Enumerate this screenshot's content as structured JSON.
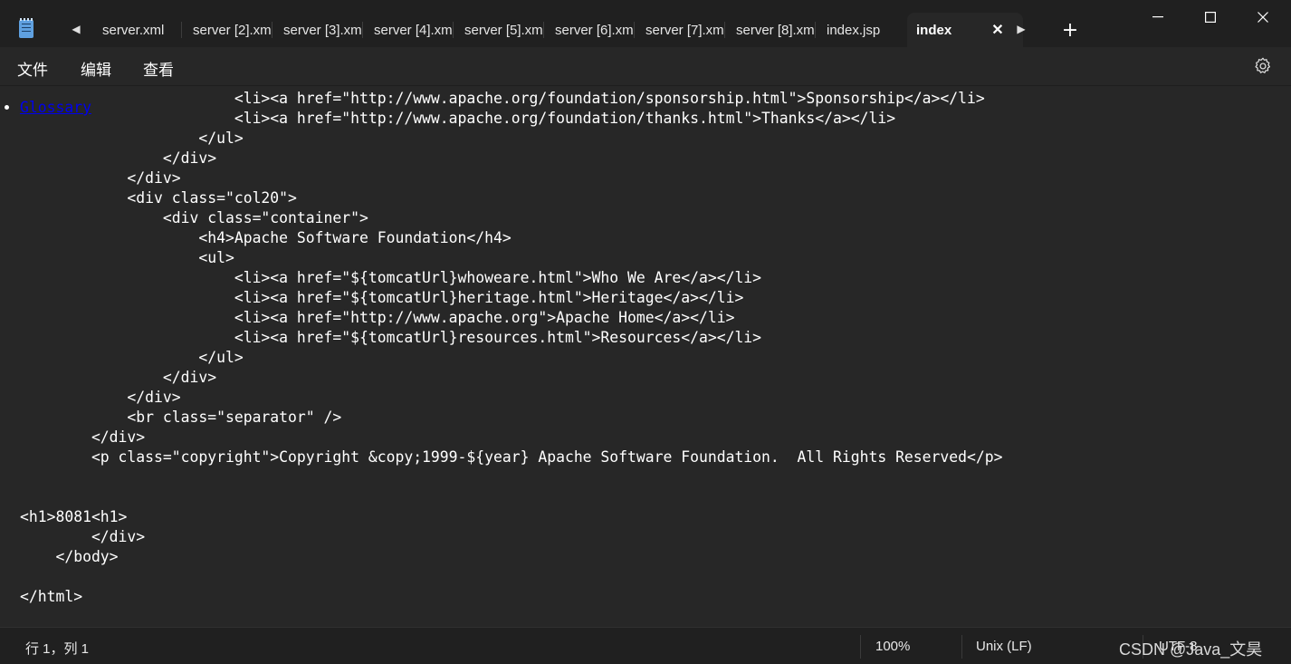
{
  "tabs": [
    {
      "label": "server.xml"
    },
    {
      "label": "server [2].xml"
    },
    {
      "label": "server [3].xml"
    },
    {
      "label": "server [4].xml"
    },
    {
      "label": "server [5].xml"
    },
    {
      "label": "server [6].xml"
    },
    {
      "label": "server [7].xml"
    },
    {
      "label": "server [8].xml"
    },
    {
      "label": "index.jsp"
    },
    {
      "label": "index",
      "active": true
    }
  ],
  "menu": {
    "file": "文件",
    "edit": "编辑",
    "view": "查看"
  },
  "code": [
    "                        <li><a href=\"http://www.apache.org/foundation/sponsorship.html\">Sponsorship</a></li>",
    "                        <li><a href=\"http://www.apache.org/foundation/thanks.html\">Thanks</a></li>",
    "                    </ul>",
    "                </div>",
    "            </div>",
    "            <div class=\"col20\">",
    "                <div class=\"container\">",
    "                    <h4>Apache Software Foundation</h4>",
    "                    <ul>",
    "                        <li><a href=\"${tomcatUrl}whoweare.html\">Who We Are</a></li>",
    "                        <li><a href=\"${tomcatUrl}heritage.html\">Heritage</a></li>",
    "                        <li><a href=\"http://www.apache.org\">Apache Home</a></li>",
    "                        <li><a href=\"${tomcatUrl}resources.html\">Resources</a></li>",
    "                    </ul>",
    "                </div>",
    "            </div>",
    "            <br class=\"separator\" />",
    "        </div>",
    "        <p class=\"copyright\">Copyright &copy;1999-${year} Apache Software Foundation.  All Rights Reserved</p>",
    "",
    "",
    "<h1>8081<h1>",
    "        </div>",
    "    </body>",
    "",
    "</html>"
  ],
  "status": {
    "position": "行 1，列 1",
    "zoom": "100%",
    "line_ending": "Unix (LF)",
    "encoding": "UTF-8"
  },
  "watermark": "CSDN @Java_文昊"
}
